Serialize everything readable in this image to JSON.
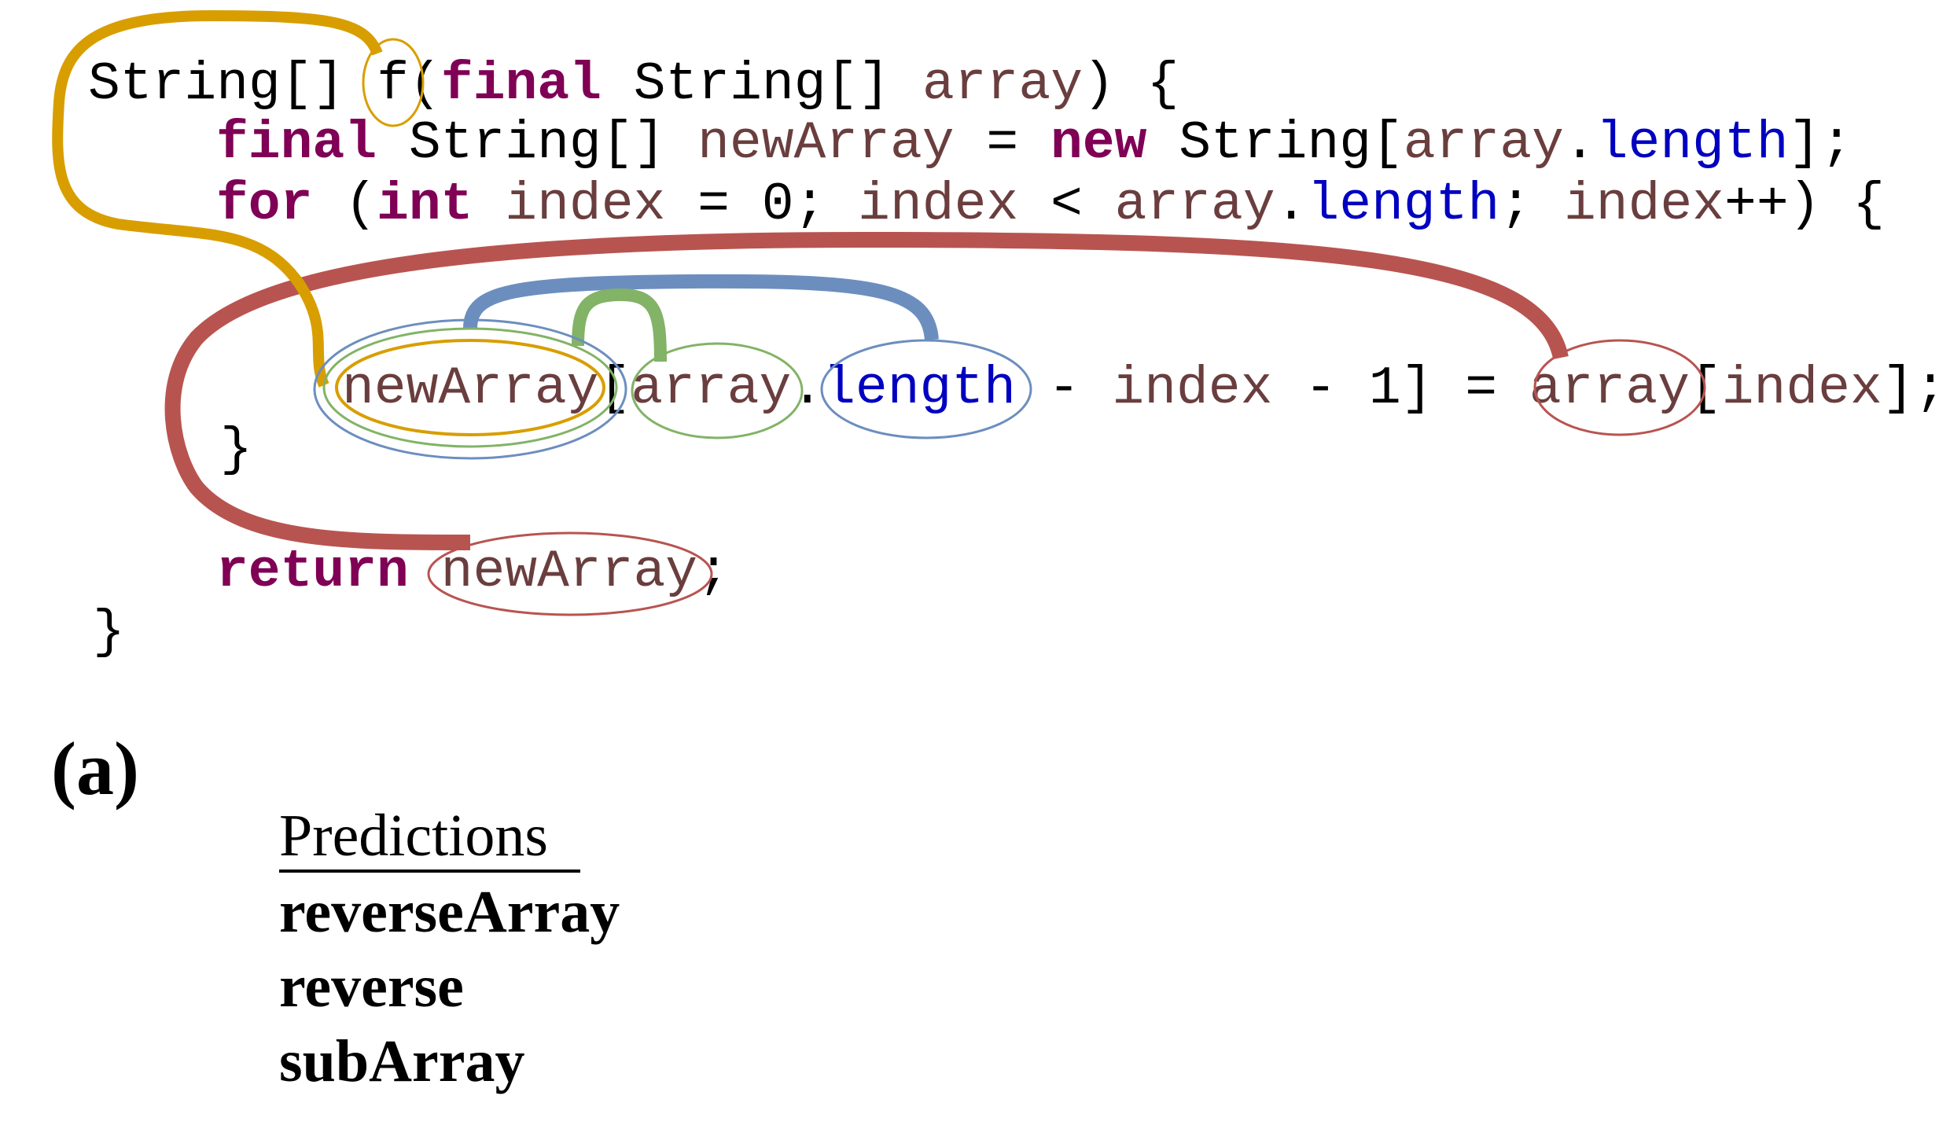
{
  "figure": {
    "panel_label": "(a)",
    "colors": {
      "keyword": "#7f0055",
      "identifier": "#6a3e3e",
      "plain": "#000000",
      "field": "#0000c0",
      "edge_orange": "#d89e00",
      "edge_red": "#b85450",
      "edge_blue": "#6c8ebf",
      "edge_green": "#82b366"
    }
  },
  "code": {
    "lines": [
      [
        {
          "t": "String[] ",
          "c": "plain"
        },
        {
          "t": "f",
          "c": "plain"
        },
        {
          "t": "(",
          "c": "plain"
        },
        {
          "t": "final",
          "c": "kw"
        },
        {
          "t": " String[] ",
          "c": "plain"
        },
        {
          "t": "array",
          "c": "ident"
        },
        {
          "t": ") {",
          "c": "plain"
        }
      ],
      [
        {
          "t": "final",
          "c": "kw"
        },
        {
          "t": " String[] ",
          "c": "plain"
        },
        {
          "t": "newArray",
          "c": "ident"
        },
        {
          "t": " = ",
          "c": "plain"
        },
        {
          "t": "new",
          "c": "kw"
        },
        {
          "t": " String[",
          "c": "plain"
        },
        {
          "t": "array",
          "c": "ident"
        },
        {
          "t": ".",
          "c": "plain"
        },
        {
          "t": "length",
          "c": "field"
        },
        {
          "t": "];",
          "c": "plain"
        }
      ],
      [
        {
          "t": "for",
          "c": "kw"
        },
        {
          "t": " (",
          "c": "plain"
        },
        {
          "t": "int",
          "c": "kw"
        },
        {
          "t": " ",
          "c": "plain"
        },
        {
          "t": "index",
          "c": "ident"
        },
        {
          "t": " = 0; ",
          "c": "plain"
        },
        {
          "t": "index",
          "c": "ident"
        },
        {
          "t": " < ",
          "c": "plain"
        },
        {
          "t": "array",
          "c": "ident"
        },
        {
          "t": ".",
          "c": "plain"
        },
        {
          "t": "length",
          "c": "field"
        },
        {
          "t": "; ",
          "c": "plain"
        },
        {
          "t": "index",
          "c": "ident"
        },
        {
          "t": "++) {",
          "c": "plain"
        }
      ],
      [
        {
          "t": "newArray",
          "c": "ident"
        },
        {
          "t": "[",
          "c": "plain"
        },
        {
          "t": "array",
          "c": "ident"
        },
        {
          "t": ".",
          "c": "plain"
        },
        {
          "t": "length",
          "c": "field"
        },
        {
          "t": " - ",
          "c": "plain"
        },
        {
          "t": "index",
          "c": "ident"
        },
        {
          "t": " - 1] = ",
          "c": "plain"
        },
        {
          "t": "array",
          "c": "ident"
        },
        {
          "t": "[",
          "c": "plain"
        },
        {
          "t": "index",
          "c": "ident"
        },
        {
          "t": "];",
          "c": "plain"
        }
      ],
      [
        {
          "t": "}",
          "c": "plain"
        }
      ],
      [
        {
          "t": "return",
          "c": "kw"
        },
        {
          "t": " ",
          "c": "plain"
        },
        {
          "t": "newArray",
          "c": "ident"
        },
        {
          "t": ";",
          "c": "plain"
        }
      ],
      [
        {
          "t": "}",
          "c": "plain"
        }
      ]
    ]
  },
  "highlights": [
    {
      "name": "method-name-f",
      "token": "f",
      "color": "orange"
    },
    {
      "name": "newArray-assign",
      "token": "newArray",
      "colors": [
        "orange",
        "green",
        "blue"
      ]
    },
    {
      "name": "array-in-index",
      "token": "array",
      "color": "green"
    },
    {
      "name": "length-field",
      "token": "length",
      "color": "blue"
    },
    {
      "name": "array-rhs",
      "token": "array",
      "color": "red"
    },
    {
      "name": "newArray-return",
      "token": "newArray",
      "color": "red"
    }
  ],
  "edges": [
    {
      "from": "method-name-f",
      "to": "newArray-assign",
      "color": "orange"
    },
    {
      "from": "newArray-assign",
      "to": "array-in-index",
      "color": "green"
    },
    {
      "from": "newArray-assign",
      "to": "length-field",
      "color": "blue"
    },
    {
      "from": "array-rhs",
      "to": "newArray-return",
      "color": "red"
    }
  ],
  "predictions": {
    "header": "Predictions",
    "items": [
      "reverseArray",
      "reverse",
      "subArray"
    ]
  }
}
